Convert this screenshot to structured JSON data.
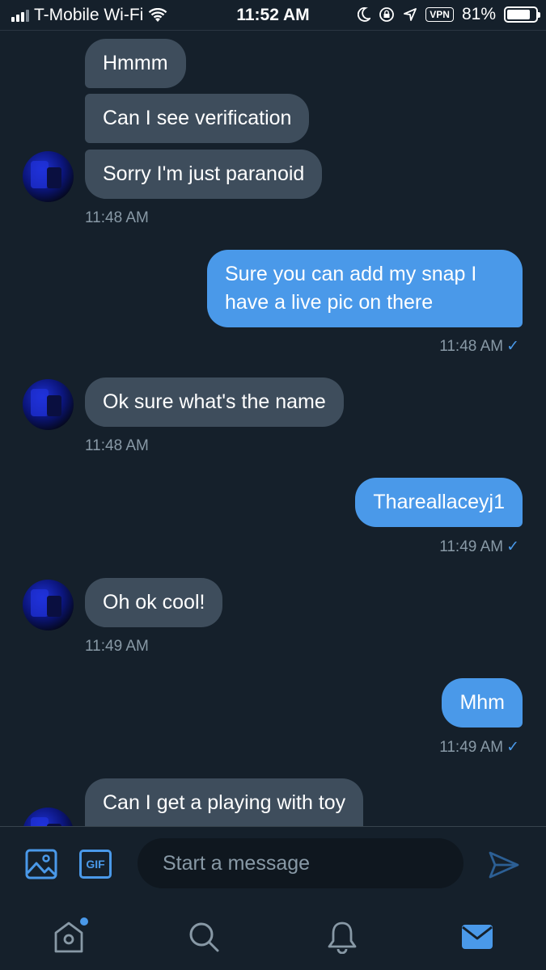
{
  "status_bar": {
    "carrier": "T-Mobile Wi-Fi",
    "time": "11:52 AM",
    "vpn": "VPN",
    "battery": "81%",
    "battery_level": 0.81
  },
  "messages": [
    {
      "text": "Hmmm",
      "direction": "incoming"
    },
    {
      "text": "Can I see verification",
      "direction": "incoming"
    },
    {
      "text": "Sorry I'm just paranoid",
      "direction": "incoming",
      "timestamp": "11:48 AM"
    },
    {
      "text": "Sure you can add my snap I have a live pic on there",
      "direction": "outgoing",
      "timestamp": "11:48 AM"
    },
    {
      "text": "Ok sure what's the name",
      "direction": "incoming",
      "timestamp": "11:48 AM"
    },
    {
      "text": "Thareallaceyj1",
      "direction": "outgoing",
      "timestamp": "11:49 AM"
    },
    {
      "text": "Oh ok cool!",
      "direction": "incoming",
      "timestamp": "11:49 AM"
    },
    {
      "text": "Mhm",
      "direction": "outgoing",
      "timestamp": "11:49 AM"
    },
    {
      "text": "Can I get a playing with toy",
      "direction": "incoming"
    }
  ],
  "read_check": "✓",
  "composer": {
    "gif_label": "GIF",
    "placeholder": "Start a message"
  },
  "tabs": [
    {
      "name": "home",
      "icon": "home-icon",
      "has_notification": true
    },
    {
      "name": "search",
      "icon": "search-icon"
    },
    {
      "name": "notifications",
      "icon": "bell-icon"
    },
    {
      "name": "messages",
      "icon": "mail-icon",
      "active": true
    }
  ],
  "colors": {
    "background": "#15202b",
    "incoming_bubble": "#3e4d5c",
    "outgoing_bubble": "#4a99e9",
    "accent": "#4a99e9",
    "timestamp": "#8899a6"
  }
}
